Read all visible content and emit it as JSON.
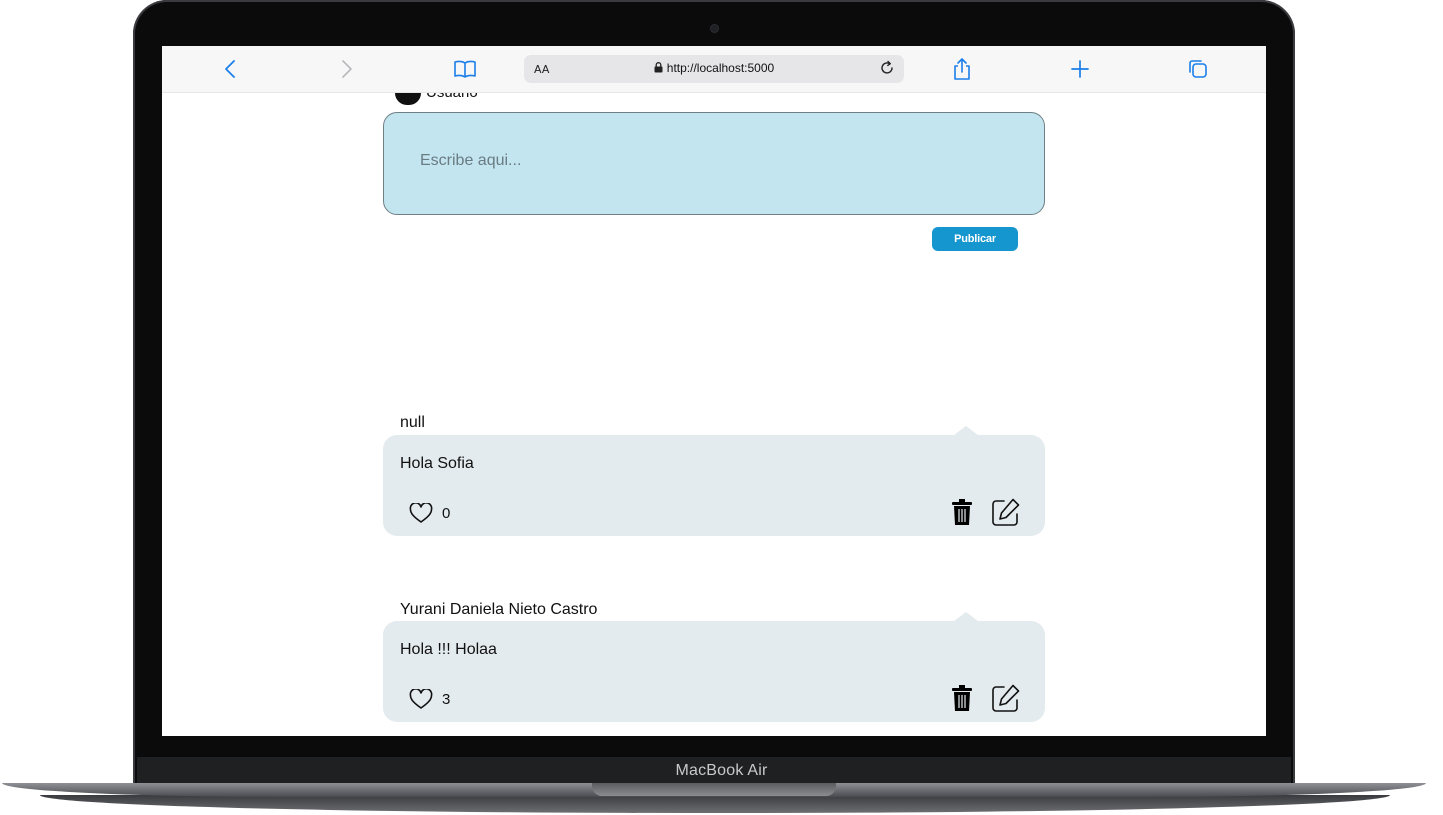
{
  "device": {
    "label": "MacBook Air"
  },
  "browser": {
    "text_size_label": "AA",
    "url": "http://localhost:5000",
    "icons": {
      "back": "chevron-left-icon",
      "forward": "chevron-right-icon",
      "bookmarks": "book-icon",
      "lock": "lock-icon",
      "reload": "reload-icon",
      "share": "share-icon",
      "new_tab": "plus-icon",
      "tabs": "tabs-icon"
    },
    "accent_color": "#1a7fe8"
  },
  "composer": {
    "user_name": "Usuario",
    "placeholder": "Escribe aqui...",
    "value": "",
    "publish_label": "Publicar",
    "background_color": "#c3e5f0",
    "button_color": "#1596cf"
  },
  "posts": [
    {
      "author": "null",
      "text": "Hola Sofia",
      "likes": "0"
    },
    {
      "author": "Yurani Daniela Nieto Castro",
      "text": "Hola !!! Holaa",
      "likes": "3"
    }
  ],
  "post_icons": {
    "like": "heart-icon",
    "delete": "trash-icon",
    "edit": "pencil-square-icon"
  }
}
